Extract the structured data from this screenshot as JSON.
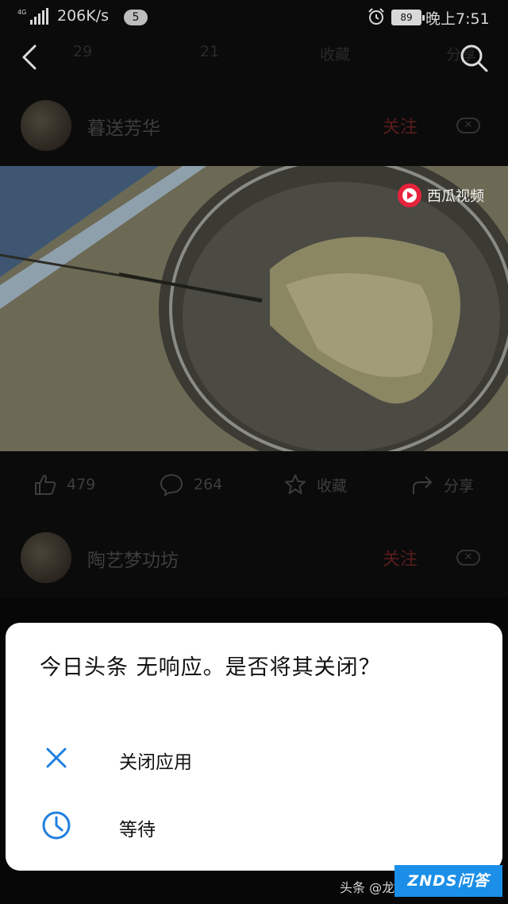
{
  "status_bar": {
    "network": "4G",
    "speed": "206K/s",
    "notification_count": "5",
    "battery": "89",
    "time": "晚上7:51"
  },
  "ghost_actions": {
    "likes": "29",
    "comments": "21",
    "favorite": "收藏",
    "share": "分享"
  },
  "posts": [
    {
      "author": "暮送芳华",
      "follow": "关注"
    },
    {
      "author": "陶艺梦功坊",
      "follow": "关注"
    }
  ],
  "video": {
    "badge": "西瓜视频"
  },
  "actions": {
    "likes": "479",
    "comments": "264",
    "favorite": "收藏",
    "share": "分享"
  },
  "dialog": {
    "title": "今日头条 无响应。是否将其关闭？",
    "options": [
      {
        "label": "关闭应用",
        "icon": "close-icon"
      },
      {
        "label": "等待",
        "icon": "clock-icon"
      }
    ]
  },
  "watermark": {
    "text": "头条 @龙",
    "logo": "ZNDS问答"
  },
  "colors": {
    "dialog_icon": "#1f7fe0",
    "follow": "#5a1c1c",
    "background": "#0b0b0b"
  }
}
